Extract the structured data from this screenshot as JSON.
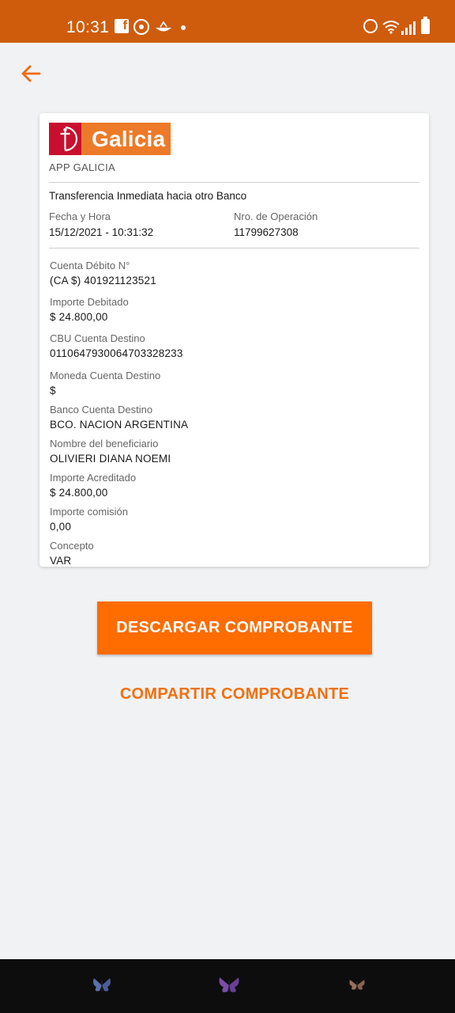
{
  "status_bar": {
    "time": "10:31",
    "icons": [
      "facebook-icon",
      "whatsapp-icon",
      "boat-icon",
      "notification-dot-icon",
      "alarm-icon",
      "wifi-icon",
      "signal-icon",
      "battery-icon"
    ]
  },
  "nav": {
    "back_icon": "arrow-left-icon"
  },
  "receipt": {
    "brand": "Galicia",
    "app_label": "APP GALICIA",
    "title": "Transferencia Inmediata hacia otro Banco",
    "datetime_label": "Fecha y Hora",
    "datetime_value": "15/12/2021 -  10:31:32",
    "operation_label": "Nro. de Operación",
    "operation_value": "11799627308",
    "fields": [
      {
        "label": "Cuenta Débito N°",
        "value": "(CA $) 401921123521"
      },
      {
        "label": "Importe Debitado",
        "value": "$ 24.800,00"
      },
      {
        "label": "CBU Cuenta Destino",
        "value": "0110647930064703328233"
      },
      {
        "label": "Moneda Cuenta Destino",
        "value": "$"
      },
      {
        "label": "Banco Cuenta Destino",
        "value": "BCO. NACION ARGENTINA"
      },
      {
        "label": "Nombre del beneficiario",
        "value": "OLIVIERI DIANA NOEMI"
      },
      {
        "label": "Importe Acreditado",
        "value": "$ 24.800,00"
      },
      {
        "label": "Importe comisión",
        "value": "0,00"
      },
      {
        "label": "Concepto",
        "value": "VAR"
      }
    ]
  },
  "actions": {
    "download_label": "DESCARGAR COMPROBANTE",
    "share_label": "COMPARTIR COMPROBANTE"
  },
  "colors": {
    "status_bar": "#cf5c0c",
    "accent": "#ff6c00",
    "brand_red": "#c8102e",
    "brand_orange": "#ed7a28"
  },
  "bottom_nav": {
    "icons": [
      "butterfly-icon-blue",
      "butterfly-icon-purple",
      "butterfly-icon-brown"
    ]
  }
}
